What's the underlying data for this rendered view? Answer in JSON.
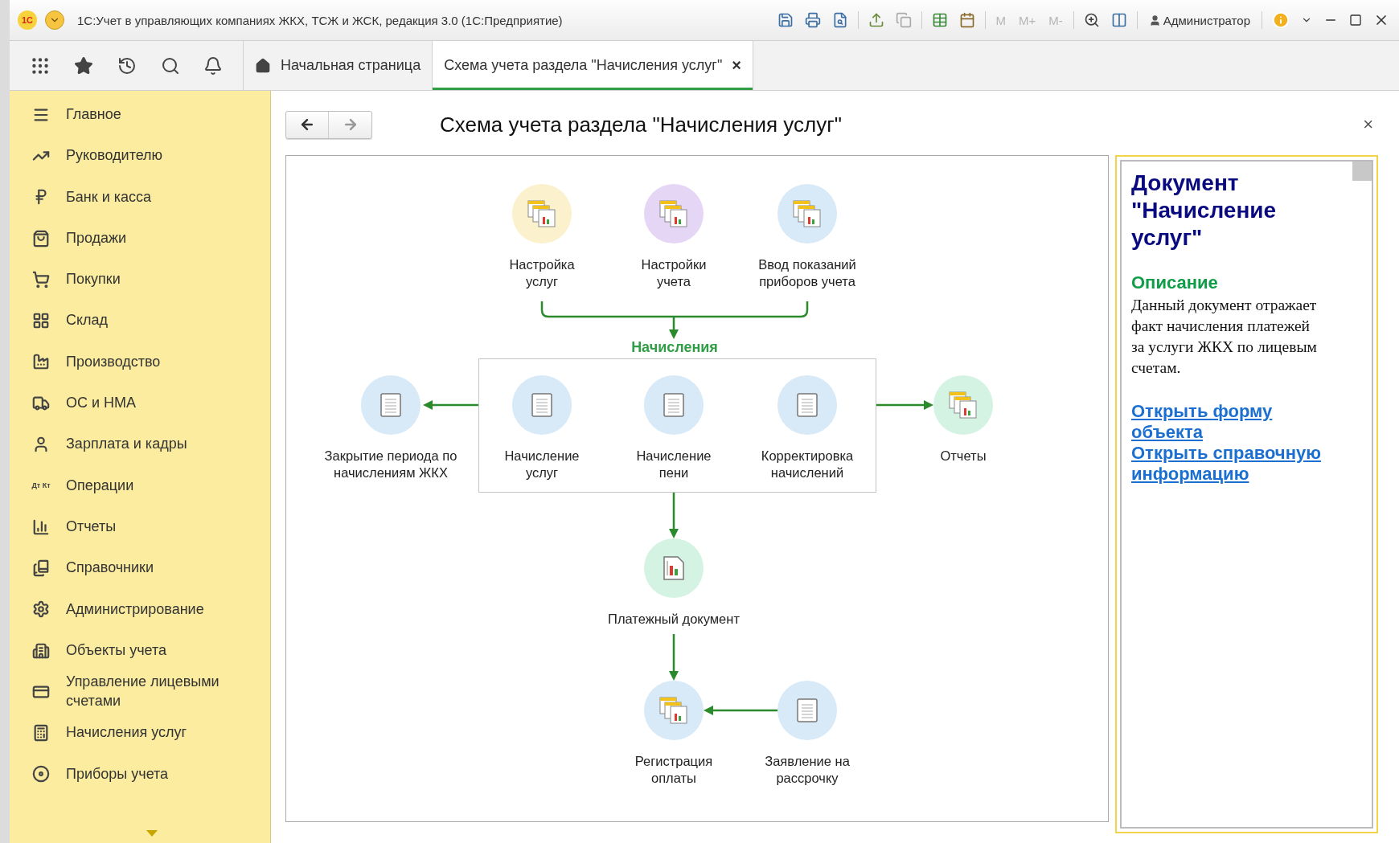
{
  "window": {
    "logo": "1С",
    "title": "1С:Учет в управляющих компаниях ЖКХ, ТСЖ и ЖСК, редакция 3.0  (1С:Предприятие)",
    "memory_buttons": [
      "M",
      "M+",
      "M-"
    ],
    "user": "Администратор"
  },
  "tabs": [
    {
      "label": "Начальная страница",
      "selected": false
    },
    {
      "label": "Схема учета раздела \"Начисления услуг\"",
      "selected": true,
      "close": "×"
    }
  ],
  "sidebar": {
    "items": [
      {
        "label": "Главное"
      },
      {
        "label": "Руководителю"
      },
      {
        "label": "Банк и касса"
      },
      {
        "label": "Продажи"
      },
      {
        "label": "Покупки"
      },
      {
        "label": "Склад"
      },
      {
        "label": "Производство"
      },
      {
        "label": "ОС и НМА"
      },
      {
        "label": "Зарплата и кадры"
      },
      {
        "label": "Операции",
        "icon_text": "Дт Кт"
      },
      {
        "label": "Отчеты"
      },
      {
        "label": "Справочники"
      },
      {
        "label": "Администрирование"
      },
      {
        "label": "Объекты учета"
      },
      {
        "label": "Управление лицевыми счетами"
      },
      {
        "label": "Начисления услуг"
      },
      {
        "label": "Приборы учета"
      }
    ]
  },
  "page": {
    "title": "Схема учета раздела \"Начисления услуг\"",
    "close": "×"
  },
  "diagram": {
    "group_label": "Начисления",
    "nodes": [
      {
        "label": "Настройка услуг",
        "kind": "report-set",
        "color": "#fbf1cc"
      },
      {
        "label": "Настройки учета",
        "kind": "report-set",
        "color": "#e6d6f6"
      },
      {
        "label": "Ввод показаний приборов учета",
        "kind": "report-set",
        "color": "#d8e9f7"
      },
      {
        "label": "Закрытие периода по начислениям ЖКХ",
        "kind": "document",
        "color": "#d8e9f7"
      },
      {
        "label": "Начисление услуг",
        "kind": "document",
        "color": "#d8e9f7"
      },
      {
        "label": "Начисление пени",
        "kind": "document",
        "color": "#d8e9f7"
      },
      {
        "label": "Корректировка начислений",
        "kind": "document",
        "color": "#d8e9f7"
      },
      {
        "label": "Отчеты",
        "kind": "report-set",
        "color": "#d5f3e2"
      },
      {
        "label": "Платежный документ",
        "kind": "report",
        "color": "#d5f3e2"
      },
      {
        "label": "Регистрация оплаты",
        "kind": "report-set",
        "color": "#d8e9f7"
      },
      {
        "label": "Заявление на рассрочку",
        "kind": "document",
        "color": "#d8e9f7"
      }
    ]
  },
  "info_panel": {
    "heading": "Документ \"Начисление услуг\"",
    "section": "Описание",
    "description": "Данный документ отражает факт начисления платежей за услуги ЖКХ по лицевым счетам.",
    "links": [
      "Открыть форму объекта",
      "Открыть справочную информацию"
    ]
  }
}
